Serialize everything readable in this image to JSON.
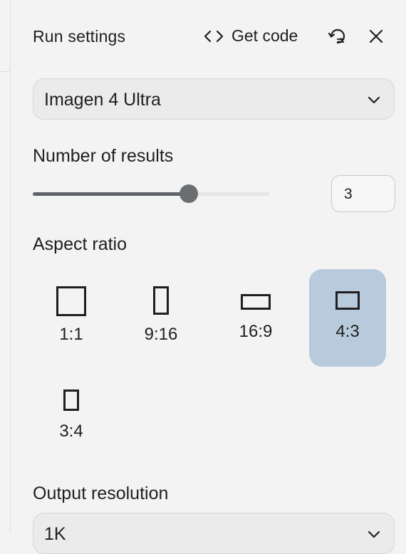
{
  "header": {
    "title": "Run settings",
    "get_code_label": "Get code"
  },
  "icons": {
    "code": "code-brackets-icon",
    "reset": "reset-settings-icon",
    "close": "close-icon",
    "chevron": "chevron-down-icon"
  },
  "model": {
    "selected": "Imagen 4 Ultra"
  },
  "number_of_results": {
    "label": "Number of results",
    "value": "3",
    "slider_fraction": 0.66
  },
  "aspect_ratio": {
    "label": "Aspect ratio",
    "options": [
      "1:1",
      "9:16",
      "16:9",
      "4:3",
      "3:4"
    ],
    "selected": "4:3"
  },
  "output_resolution": {
    "label": "Output resolution",
    "selected": "1K"
  },
  "colors": {
    "selected_bg": "#b8cbdc",
    "slider_fill": "#5f6368",
    "panel_bg": "#f3f3f3"
  }
}
